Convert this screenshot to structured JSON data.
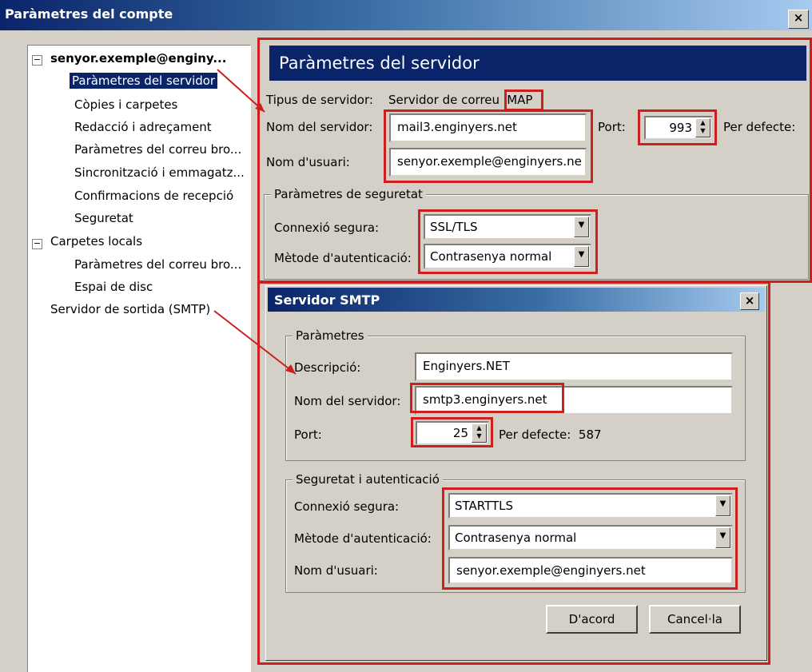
{
  "window": {
    "title": "Paràmetres del compte",
    "close_label": "×"
  },
  "tree": {
    "account": "senyor.exemple@enginy...",
    "items": [
      "Paràmetres del servidor",
      "Còpies i carpetes",
      "Redacció i adreçament",
      "Paràmetres del correu bro...",
      "Sincronització i emmagatz...",
      "Confirmacions de recepció",
      "Seguretat"
    ],
    "local_folders": "Carpetes locals",
    "local_items": [
      "Paràmetres del correu bro...",
      "Espai de disc"
    ],
    "smtp": "Servidor de sortida (SMTP)",
    "expander_label": "−"
  },
  "server": {
    "header": "Paràmetres del servidor",
    "type_label": "Tipus de servidor:",
    "type_value": "Servidor de correu",
    "type_protocol": "IMAP",
    "hostname_label": "Nom del servidor:",
    "hostname_value": "mail3.enginyers.net",
    "port_label": "Port:",
    "port_value": "993",
    "default_label": "Per defecte:",
    "username_label": "Nom d'usuari:",
    "username_value": "senyor.exemple@enginyers.ne",
    "security_group": "Paràmetres de seguretat",
    "secure_conn_label": "Connexió segura:",
    "secure_conn_value": "SSL/TLS",
    "auth_label": "Mètode d'autenticació:",
    "auth_value": "Contrasenya normal"
  },
  "smtp_dialog": {
    "title": "Servidor SMTP",
    "close_label": "×",
    "params_group": "Paràmetres",
    "description_label": "Descripció:",
    "description_value": "Enginyers.NET",
    "hostname_label": "Nom del servidor:",
    "hostname_value": "smtp3.enginyers.net",
    "port_label": "Port:",
    "port_value": "25",
    "default_label": "Per defecte:",
    "default_value": "587",
    "security_group": "Seguretat i autenticació",
    "secure_conn_label": "Connexió segura:",
    "secure_conn_value": "STARTTLS",
    "auth_label": "Mètode d'autenticació:",
    "auth_value": "Contrasenya normal",
    "username_label": "Nom d'usuari:",
    "username_value": "senyor.exemple@enginyers.net",
    "ok_label": "D'acord",
    "cancel_label": "Cancel·la"
  },
  "colors": {
    "highlight": "#cc1f1f",
    "selection": "#0a246a",
    "window_bg": "#d4d0c8"
  }
}
